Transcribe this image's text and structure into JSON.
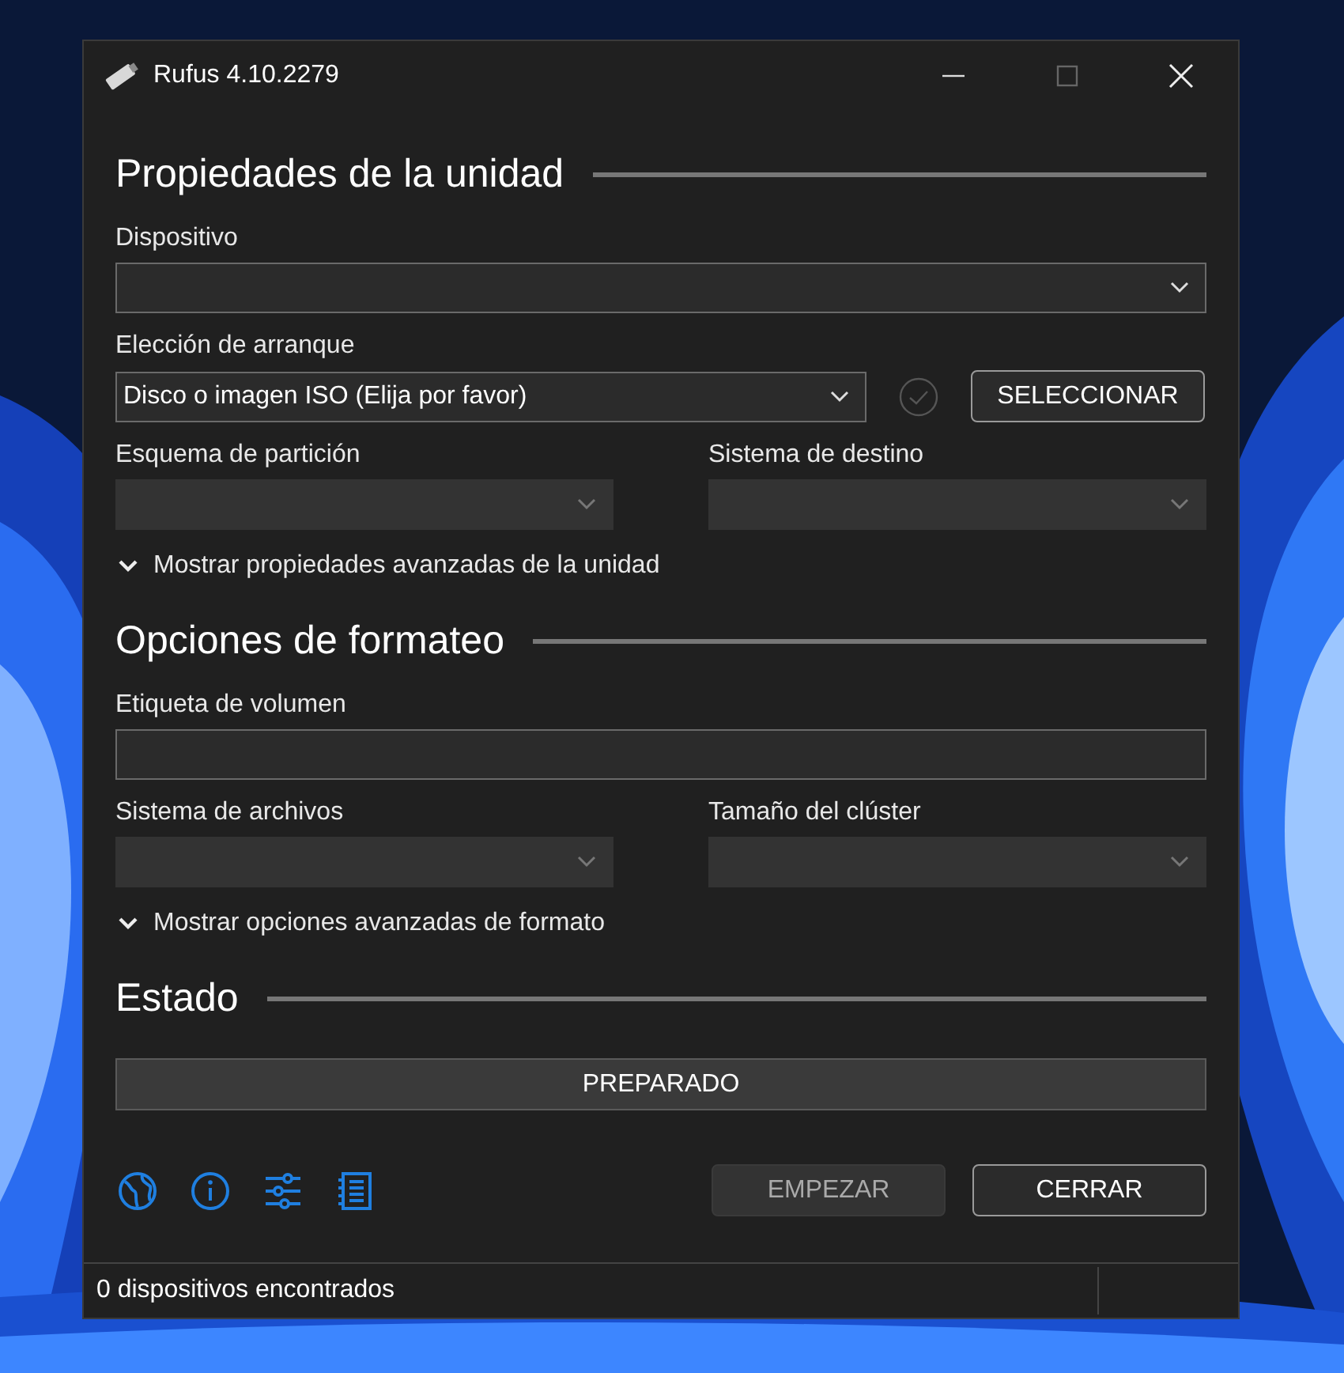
{
  "window": {
    "title": "Rufus 4.10.2279"
  },
  "sections": [
    {
      "heading": "Propiedades de la unidad",
      "rows": [
        {
          "kind": "select",
          "label": "Dispositivo",
          "disabled": false
        },
        {
          "kind": "select_button",
          "label": "Elección de arranque",
          "value": "Disco o imagen ISO (Elija por favor)",
          "disabled": false,
          "button": "SELECCIONAR"
        },
        {
          "kind": "pair",
          "fields": [
            {
              "label": "Esquema de partición",
              "disabled": true
            },
            {
              "label": "Sistema de destino",
              "disabled": true
            }
          ]
        },
        {
          "kind": "expander",
          "label": "Mostrar propiedades avanzadas de la unidad",
          "expanded": false
        }
      ]
    },
    {
      "heading": "Opciones de formateo",
      "rows": [
        {
          "kind": "text",
          "label": "Etiqueta de volumen"
        },
        {
          "kind": "pair",
          "fields": [
            {
              "label": "Sistema de archivos",
              "disabled": true
            },
            {
              "label": "Tamaño del clúster",
              "disabled": true
            }
          ]
        },
        {
          "kind": "expander",
          "label": "Mostrar opciones avanzadas de formato",
          "expanded": false
        }
      ]
    },
    {
      "heading": "Estado",
      "rows": [
        {
          "kind": "progress",
          "label": "PREPARADO",
          "level": 0
        }
      ]
    }
  ],
  "buttons": [
    {
      "label": "EMPEZAR",
      "disabled": true
    },
    {
      "label": "CERRAR",
      "disabled": false
    }
  ],
  "status_bar": {
    "text": "0 dispositivos encontrados"
  }
}
